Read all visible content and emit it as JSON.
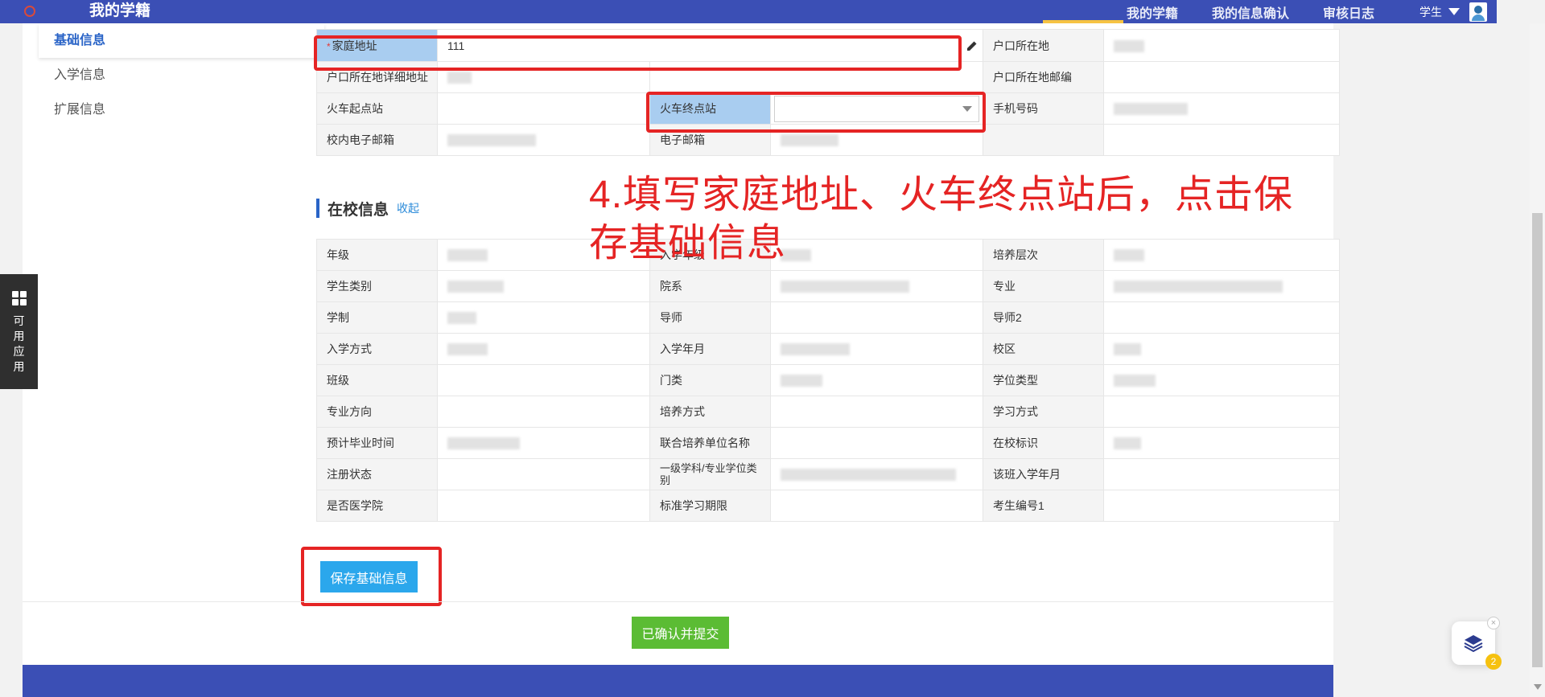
{
  "header": {
    "app_title": "我的学籍",
    "nav": [
      "我的学籍",
      "我的信息确认",
      "审核日志"
    ],
    "role": "学生"
  },
  "sidebar": {
    "items": [
      {
        "label": "基础信息",
        "active": true
      },
      {
        "label": "入学信息",
        "active": false
      },
      {
        "label": "扩展信息",
        "active": false
      }
    ]
  },
  "basic_info": {
    "home_address_label": "家庭地址",
    "home_address_value": "111",
    "hukou_location_label": "户口所在地",
    "hukou_detail_label": "户口所在地详细地址",
    "hukou_postcode_label": "户口所在地邮编",
    "train_start_label": "火车起点站",
    "train_end_label": "火车终点站",
    "train_end_value": "",
    "phone_label": "手机号码",
    "campus_email_label": "校内电子邮箱",
    "email_label": "电子邮箱"
  },
  "school_section": {
    "title": "在校信息",
    "collapse": "收起",
    "rows": [
      [
        "年级",
        "入学年级",
        "培养层次"
      ],
      [
        "学生类别",
        "院系",
        "专业"
      ],
      [
        "学制",
        "导师",
        "导师2"
      ],
      [
        "入学方式",
        "入学年月",
        "校区"
      ],
      [
        "班级",
        "门类",
        "学位类型"
      ],
      [
        "专业方向",
        "培养方式",
        "学习方式"
      ],
      [
        "预计毕业时间",
        "联合培养单位名称",
        "在校标识"
      ],
      [
        "注册状态",
        "一级学科/专业学位类别",
        "该班入学年月"
      ],
      [
        "是否医学院",
        "标准学习期限",
        "考生编号1"
      ]
    ]
  },
  "annotation": "4.填写家庭地址、火车终点站后，点击保存基础信息",
  "buttons": {
    "save": "保存基础信息",
    "submit": "已确认并提交"
  },
  "dock": {
    "label": "可用应用"
  },
  "layer_widget": {
    "badge": "2"
  },
  "colors": {
    "primary": "#3b4fb5",
    "accent_underline": "#f6c343",
    "annotation_red": "#e52424",
    "save_button": "#2ba7ec",
    "submit_button": "#5bbc34"
  }
}
